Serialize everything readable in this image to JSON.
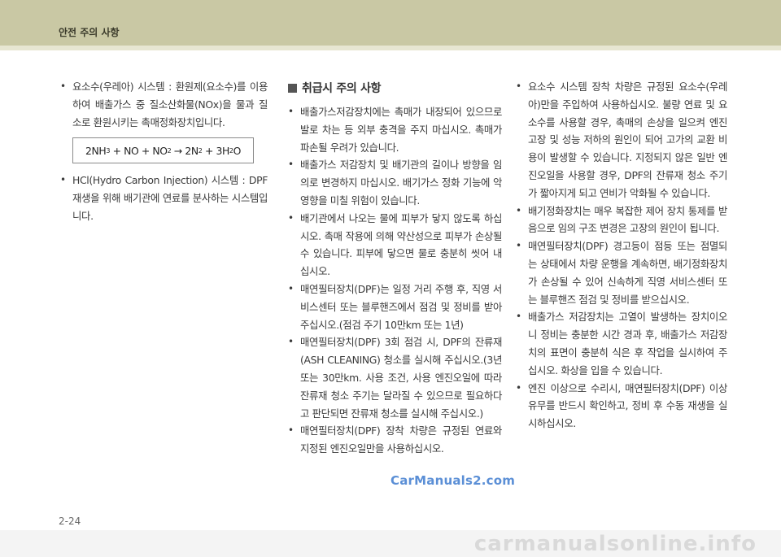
{
  "header": {
    "title": "안전 주의 사항"
  },
  "col1": {
    "items": [
      "요소수(우레아) 시스템 : 환원제(요소수)를 이용하여 배출가스 중 질소산화물(NOx)을 물과 질소로 환원시키는 촉매정화장치입니다.",
      "HCl(Hydro Carbon Injection) 시스템 : DPF 재생을 위해 배기관에 연료를 분사하는 시스템입니다."
    ],
    "formula": {
      "a": "2NH",
      "a_sub": "3",
      "b": " + NO + NO",
      "b_sub": "2",
      "arrow": " → ",
      "c": "2N",
      "c_sub": "2",
      "d": " + 3H",
      "d_sub": "2",
      "e": "O"
    }
  },
  "col2": {
    "section_title": "취급시 주의 사항",
    "items": [
      "배출가스저감장치에는 촉매가 내장되어 있으므로 발로 차는 등 외부 충격을 주지 마십시오. 촉매가 파손될 우려가 있습니다.",
      "배출가스 저감장치 및 배기관의 길이나 방향을 임의로 변경하지 마십시오. 배기가스 정화 기능에 악영향을 미칠 위험이 있습니다.",
      "배기관에서 나오는 물에 피부가 닿지 않도록 하십시오. 촉매 작용에 의해 약산성으로 피부가 손상될 수 있습니다. 피부에 닿으면 물로 충분히 씻어 내십시오.",
      "매연필터장치(DPF)는 일정 거리 주행 후, 직영 서비스센터 또는 블루핸즈에서 점검 및 정비를 받아 주십시오.(점검 주기 10만km 또는 1년)",
      "매연필터장치(DPF) 3회 점검 시, DPF의 잔류재(ASH CLEANING) 청소를 실시해 주십시오.(3년 또는 30만km. 사용 조건, 사용 엔진오일에 따라 잔류재 청소 주기는 달라질 수 있으므로 필요하다고 판단되면 잔류재 청소를 실시해 주십시오.)",
      "매연필터장치(DPF) 장착 차량은 규정된 연료와 지정된 엔진오일만을 사용하십시오."
    ]
  },
  "col3": {
    "items": [
      "요소수 시스템 장착 차량은 규정된 요소수(우레아)만을 주입하여 사용하십시오. 불량 연료 및 요소수를 사용할 경우, 촉매의 손상을 일으켜 엔진 고장 및 성능 저하의 원인이 되어 고가의 교환 비용이 발생할 수 있습니다. 지정되지 않은 일반 엔진오일을 사용할 경우, DPF의 잔류재 청소 주기가 짧아지게 되고 연비가 악화될 수 있습니다.",
      "배기정화장치는 매우 복잡한 제어 장치 통제를 받음으로 임의 구조 변경은 고장의 원인이 됩니다.",
      "매연필터장치(DPF) 경고등이 점등 또는 점멸되는 상태에서 차량 운행을 계속하면, 배기정화장치가 손상될 수 있어 신속하게 직영 서비스센터 또는 블루핸즈 점검 및 정비를 받으십시오.",
      "배출가스 저감장치는 고열이 발생하는 장치이오니 정비는 충분한 시간 경과 후, 배출가스 저감장치의 표면이 충분히 식은 후 작업을 실시하여 주십시오. 화상을 입을 수 있습니다.",
      "엔진 이상으로 수리시, 매연필터장치(DPF) 이상 유무를 반드시 확인하고, 정비 후 수동 재생을 실시하십시오."
    ]
  },
  "footer": {
    "page_number": "2-24",
    "watermark": "CarManuals2.com",
    "watermark_bottom": "carmanualsonline.info"
  },
  "bullet": "•"
}
